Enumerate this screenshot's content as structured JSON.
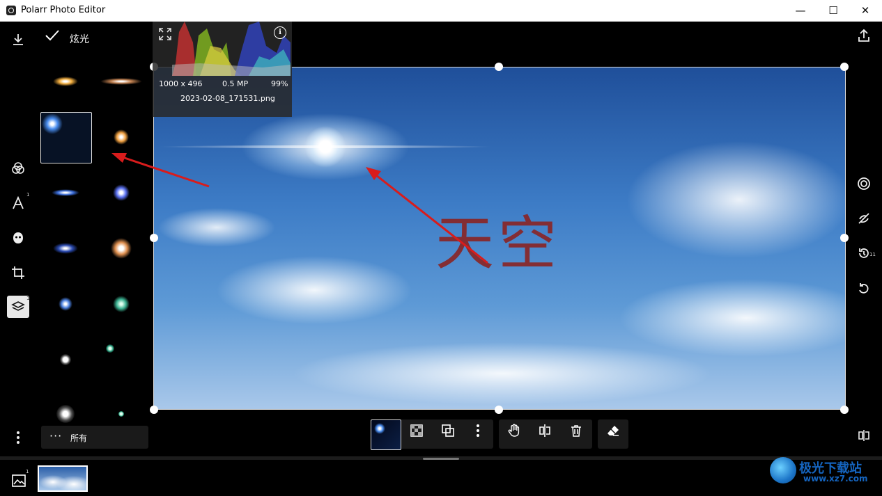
{
  "window": {
    "title": "Polarr Photo Editor",
    "min": "—",
    "max": "☐",
    "close": "✕"
  },
  "panel": {
    "title": "炫光",
    "filter_label": "所有",
    "filter_dots": "···"
  },
  "left_rail": {
    "badges": {
      "text": "1",
      "layers": "1"
    }
  },
  "image_info": {
    "dimensions": "1000 x 496",
    "megapixels": "0.5 MP",
    "zoom": "99%",
    "filename": "2023-02-08_171531.png",
    "info_glyph": "i"
  },
  "canvas": {
    "watermark_text": "天空"
  },
  "right_rail": {
    "history_badge": "11"
  },
  "filmstrip": {
    "count_badge": "1"
  },
  "logo": {
    "brand": "极光下载站",
    "domain": "www.xz7.com"
  },
  "icons": {
    "download": "download-icon",
    "confirm": "check-icon",
    "expand": "expand-icon",
    "share": "share-icon"
  }
}
